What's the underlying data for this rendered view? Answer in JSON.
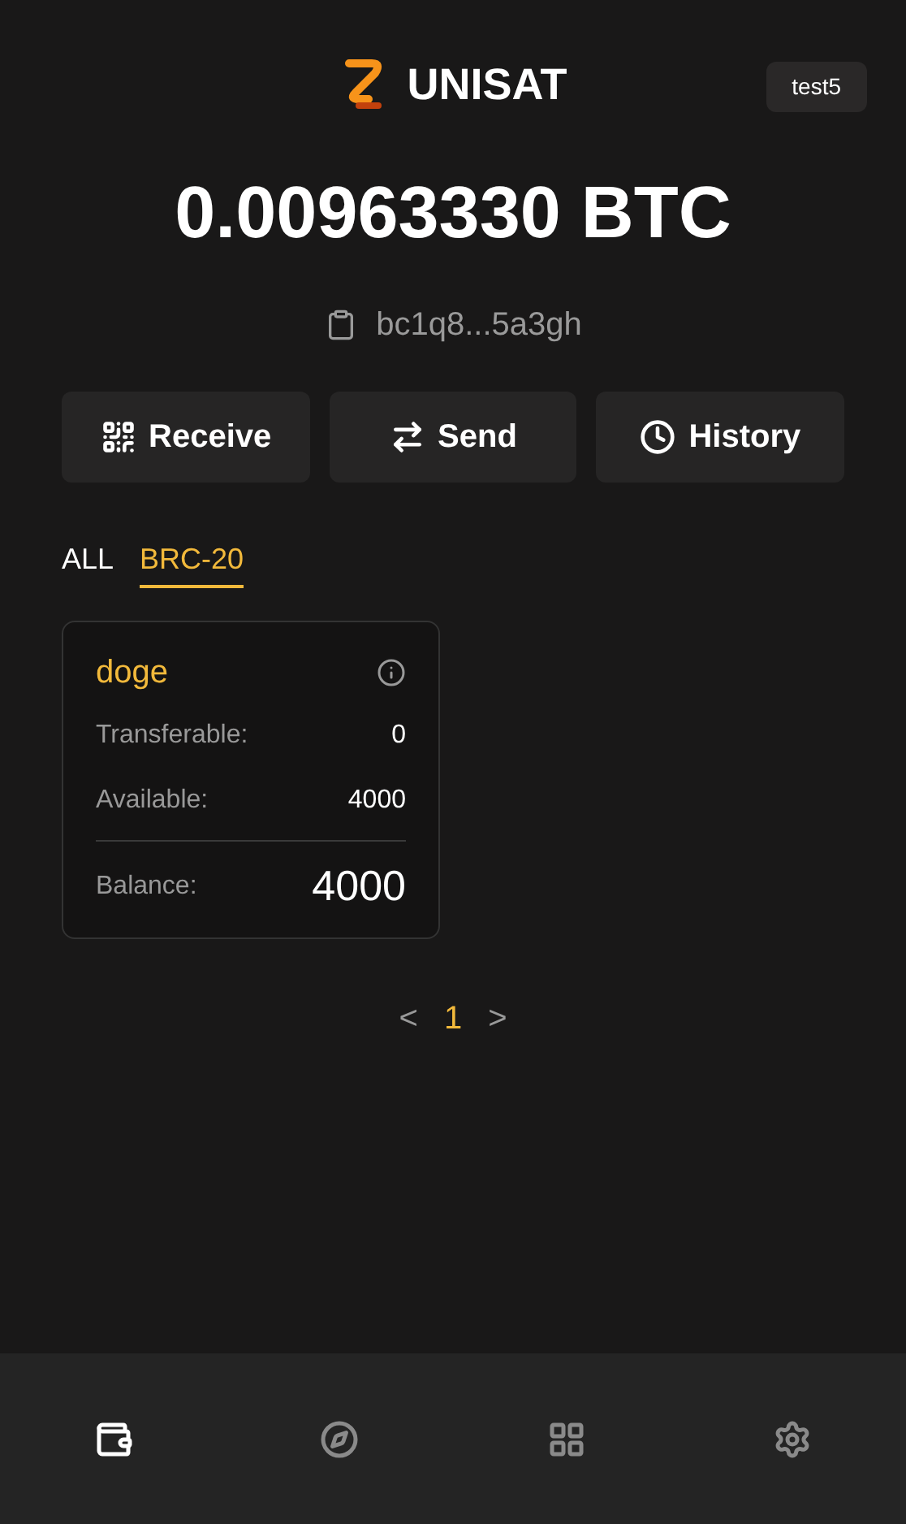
{
  "header": {
    "brand": "UNISAT",
    "account": "test5"
  },
  "balance": "0.00963330 BTC",
  "address": "bc1q8...5a3gh",
  "actions": [
    {
      "kind": "receive",
      "label": "Receive"
    },
    {
      "kind": "send",
      "label": "Send"
    },
    {
      "kind": "history",
      "label": "History"
    }
  ],
  "tabs": [
    {
      "label": "ALL",
      "selected": false
    },
    {
      "label": "BRC-20",
      "selected": true
    }
  ],
  "tokens": [
    {
      "name": "doge",
      "transferable_label": "Transferable:",
      "transferable": "0",
      "available_label": "Available:",
      "available": "4000",
      "balance_label": "Balance:",
      "balance": "4000"
    }
  ],
  "pagination": {
    "prev": "<",
    "pages": [
      {
        "label": "1",
        "selected": true
      }
    ],
    "next": ">"
  },
  "nav": [
    {
      "kind": "wallet",
      "selected": true
    },
    {
      "kind": "compass",
      "selected": false
    },
    {
      "kind": "apps",
      "selected": false
    },
    {
      "kind": "settings",
      "selected": false
    }
  ]
}
